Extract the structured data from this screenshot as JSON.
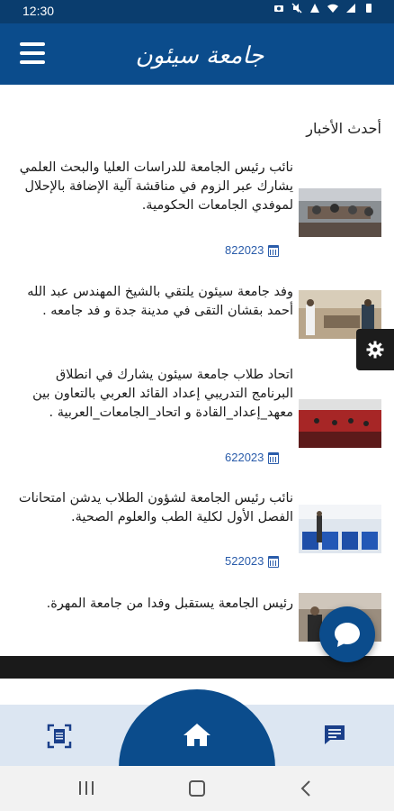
{
  "status_bar": {
    "time": "12:30",
    "icons": [
      "camera-icon",
      "mute-icon",
      "alert-icon",
      "wifi-icon",
      "signal-icon",
      "battery-icon"
    ]
  },
  "header": {
    "logo_text": "جامعة سيئون",
    "menu_icon": "hamburger-menu-icon"
  },
  "section": {
    "title": "أحدث الأخبار"
  },
  "news": [
    {
      "text": "نائب رئيس الجامعة للدراسات العليا والبحث العلمي يشارك عبر الزوم في مناقشة آلية الإضافة بالإحلال لموفدي الجامعات الحكومية.",
      "date": "822023"
    },
    {
      "text": "وفد جامعة سيئون يلتقي بالشيخ المهندس عبد الله أحمد بقشان التقى في مدينة جدة و فد جامعه .",
      "date": ""
    },
    {
      "text": "اتحاد طلاب جامعة سيئون يشارك في انطلاق البرنامج التدريبي إعداد القائد العربي بالتعاون بين معهد_إعداد_القادة و اتحاد_الجامعات_العربية .",
      "date": "622023"
    },
    {
      "text": "نائب رئيس الجامعة لشؤون الطلاب يدشن امتحانات الفصل الأول لكلية الطب والعلوم الصحية.",
      "date": "522023"
    },
    {
      "text": "رئيس الجامعة يستقبل وفدا من جامعة المهرة.",
      "date": ""
    }
  ],
  "colors": {
    "primary": "#0b4c8c",
    "status_bar": "#0a3d6e",
    "date_text": "#2a5caa",
    "bottom_nav_bg": "#dce6f2"
  },
  "bottom_nav": {
    "left_icon": "scan-document-icon",
    "center_icon": "home-icon",
    "right_icon": "message-icon"
  },
  "floating": {
    "settings_icon": "gear-icon",
    "chat_icon": "chat-bubble-icon"
  }
}
